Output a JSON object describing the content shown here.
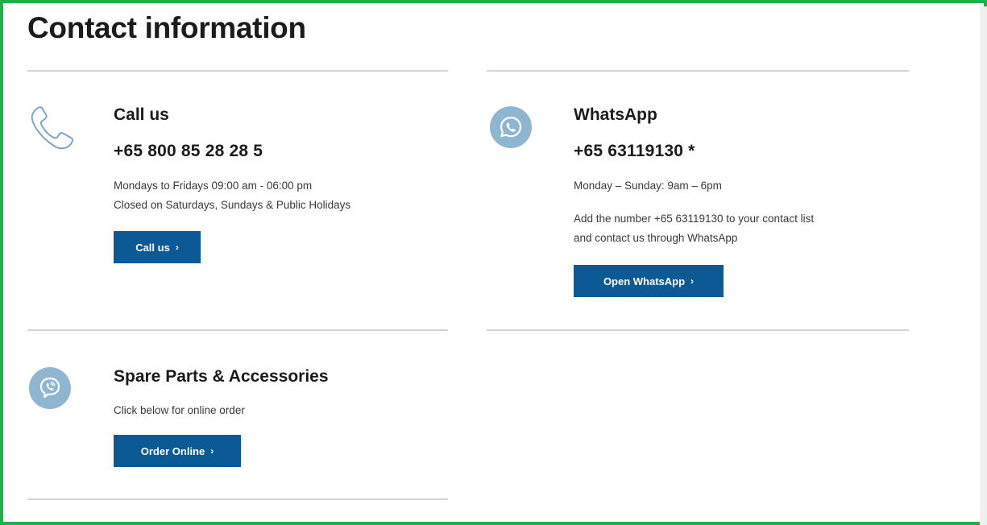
{
  "page": {
    "title": "Contact information"
  },
  "call": {
    "icon": "phone-icon",
    "heading": "Call us",
    "number": "+65 800 85 28 28 5",
    "hours_line1": "Mondays to Fridays 09:00 am - 06:00 pm",
    "hours_line2": "Closed on Saturdays, Sundays & Public Holidays",
    "button_label": "Call us",
    "button_chevron": "›"
  },
  "whatsapp": {
    "icon": "whatsapp-icon",
    "heading": "WhatsApp",
    "number": "+65 63119130 *",
    "hours": "Monday – Sunday: 9am – 6pm",
    "note_line1": "Add the number +65 63119130 to your contact list",
    "note_line2": "and contact us through WhatsApp",
    "button_label": "Open WhatsApp",
    "button_chevron": "›"
  },
  "spare_parts": {
    "icon": "viber-icon",
    "heading": "Spare Parts & Accessories",
    "description": "Click below for online order",
    "button_label": "Order Online",
    "button_chevron": "›"
  },
  "colors": {
    "frame_border": "#1fb04a",
    "button_bg": "#0b5a96",
    "icon_circle": "#8fb6d1",
    "divider": "#d4d4d4"
  }
}
